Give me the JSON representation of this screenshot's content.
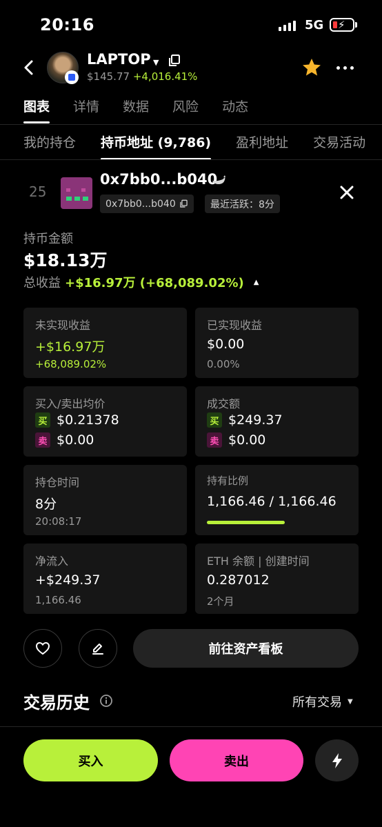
{
  "status_bar": {
    "time": "20:16",
    "network": "5G"
  },
  "header": {
    "token_name": "LAPTOP",
    "price": "$145.77",
    "change": "+4,016.41%",
    "colors": {
      "accent_green": "#b8f03a",
      "accent_pink": "#ff44b4",
      "star": "#f7b52c"
    }
  },
  "main_tabs": [
    {
      "label": "图表"
    },
    {
      "label": "详情"
    },
    {
      "label": "数据"
    },
    {
      "label": "风险"
    },
    {
      "label": "动态"
    }
  ],
  "sub_tabs": [
    {
      "label": "我的持仓"
    },
    {
      "label": "持币地址 (9,786)"
    },
    {
      "label": "盈利地址"
    },
    {
      "label": "交易活动"
    }
  ],
  "holder": {
    "rank": "25",
    "address": "0x7bb0...b040",
    "address_chip": "0x7bb0...b040",
    "last_active": "最近活跃：8分"
  },
  "holdings": {
    "label": "持币金额",
    "value": "$18.13万",
    "pnl_label": "总收益",
    "pnl_value": "+$16.97万 (+68,089.02%)"
  },
  "cards": {
    "unrealized": {
      "label": "未实现收益",
      "value": "+$16.97万",
      "sub": "+68,089.02%"
    },
    "realized": {
      "label": "已实现收益",
      "value": "$0.00",
      "sub": "0.00%"
    },
    "avg_price": {
      "label": "买入/卖出均价",
      "buy_tag": "买",
      "buy": "$0.21378",
      "sell_tag": "卖",
      "sell": "$0.00"
    },
    "volume": {
      "label": "成交额",
      "buy_tag": "买",
      "buy": "$249.37",
      "sell_tag": "卖",
      "sell": "$0.00"
    },
    "hold_time": {
      "label": "持仓时间",
      "value": "8分",
      "sub": "20:08:17"
    },
    "hold_ratio": {
      "label": "持有比例",
      "value": "1,166.46 / 1,166.46",
      "fill_fraction": 1.0
    },
    "net_flow": {
      "label": "净流入",
      "value": "+$249.37",
      "sub": "1,166.46"
    },
    "eth_balance": {
      "label": "ETH 余额 | 创建时间",
      "value": "0.287012",
      "sub": "2个月"
    }
  },
  "actions": {
    "dashboard": "前往资产看板"
  },
  "history": {
    "title": "交易历史",
    "filter": "所有交易"
  },
  "bottom": {
    "buy": "买入",
    "sell": "卖出"
  }
}
